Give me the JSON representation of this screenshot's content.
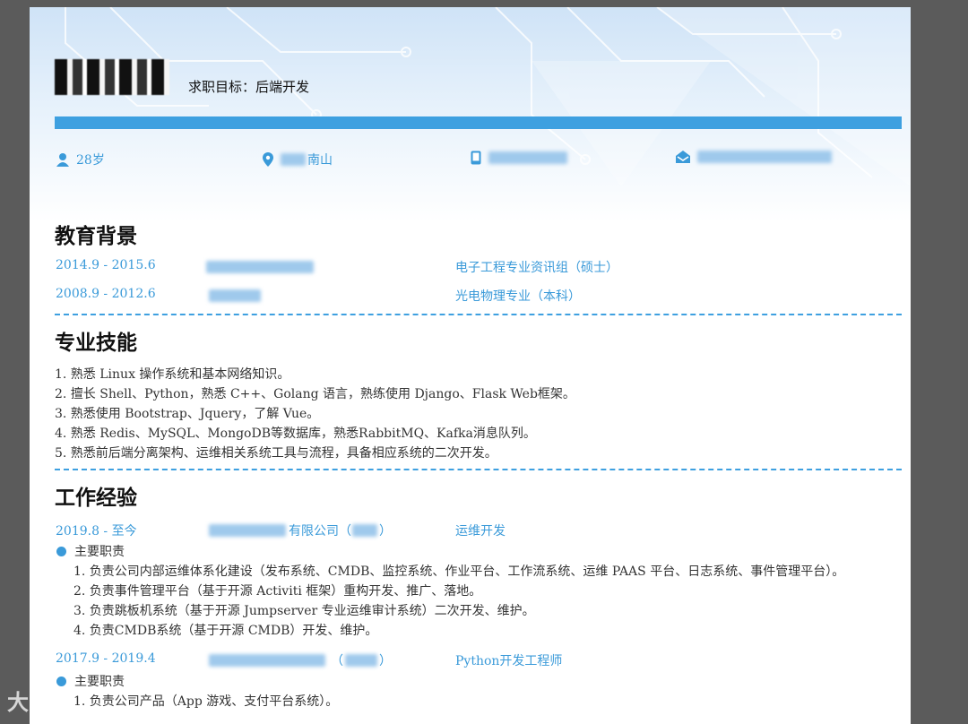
{
  "header": {
    "target_label": "求职目标：后端开发",
    "info": [
      {
        "icon": "person-icon",
        "text": "28岁"
      },
      {
        "icon": "location-pin-icon",
        "text": "南山"
      },
      {
        "icon": "phone-icon",
        "text": ""
      },
      {
        "icon": "envelope-icon",
        "text": ""
      }
    ]
  },
  "education": {
    "title": "教育背景",
    "rows": [
      {
        "period": "2014.9 - 2015.6",
        "major": "电子工程专业资讯组（硕士）"
      },
      {
        "period": "2008.9 - 2012.6",
        "major": "光电物理专业（本科）"
      }
    ]
  },
  "skills": {
    "title": "专业技能",
    "items": [
      "1. 熟悉 Linux 操作系统和基本网络知识。",
      "2. 擅长 Shell、Python，熟悉 C++、Golang 语言，熟练使用 Django、Flask Web框架。",
      "3. 熟悉使用 Bootstrap、Jquery，了解 Vue。",
      "4. 熟悉 Redis、MySQL、MongoDB等数据库，熟悉RabbitMQ、Kafka消息队列。",
      "5. 熟悉前后端分离架构、运维相关系统工具与流程，具备相应系统的二次开发。"
    ]
  },
  "work": {
    "title": "工作经验",
    "jobs": [
      {
        "period": "2019.8 - 至今",
        "company_visible": "有限公司（",
        "company_tail": "）",
        "role": "运维开发",
        "duty_head": "主要职责",
        "duties": [
          "1. 负责公司内部运维体系化建设（发布系统、CMDB、监控系统、作业平台、工作流系统、运维 PAAS 平台、日志系统、事件管理平台）。",
          "2. 负责事件管理平台（基于开源 Activiti 框架）重构开发、推广、落地。",
          "3. 负责跳板机系统（基于开源 Jumpserver 专业运维审计系统）二次开发、维护。",
          "4. 负责CMDB系统（基于开源 CMDB）开发、维护。"
        ]
      },
      {
        "period": "2017.9 - 2019.4",
        "company_visible": "（",
        "company_tail": "）",
        "role": "Python开发工程师",
        "duty_head": "主要职责",
        "duties": [
          "1. 负责公司产品（App 游戏、支付平台系统）。"
        ]
      }
    ]
  },
  "watermark": "大数据"
}
